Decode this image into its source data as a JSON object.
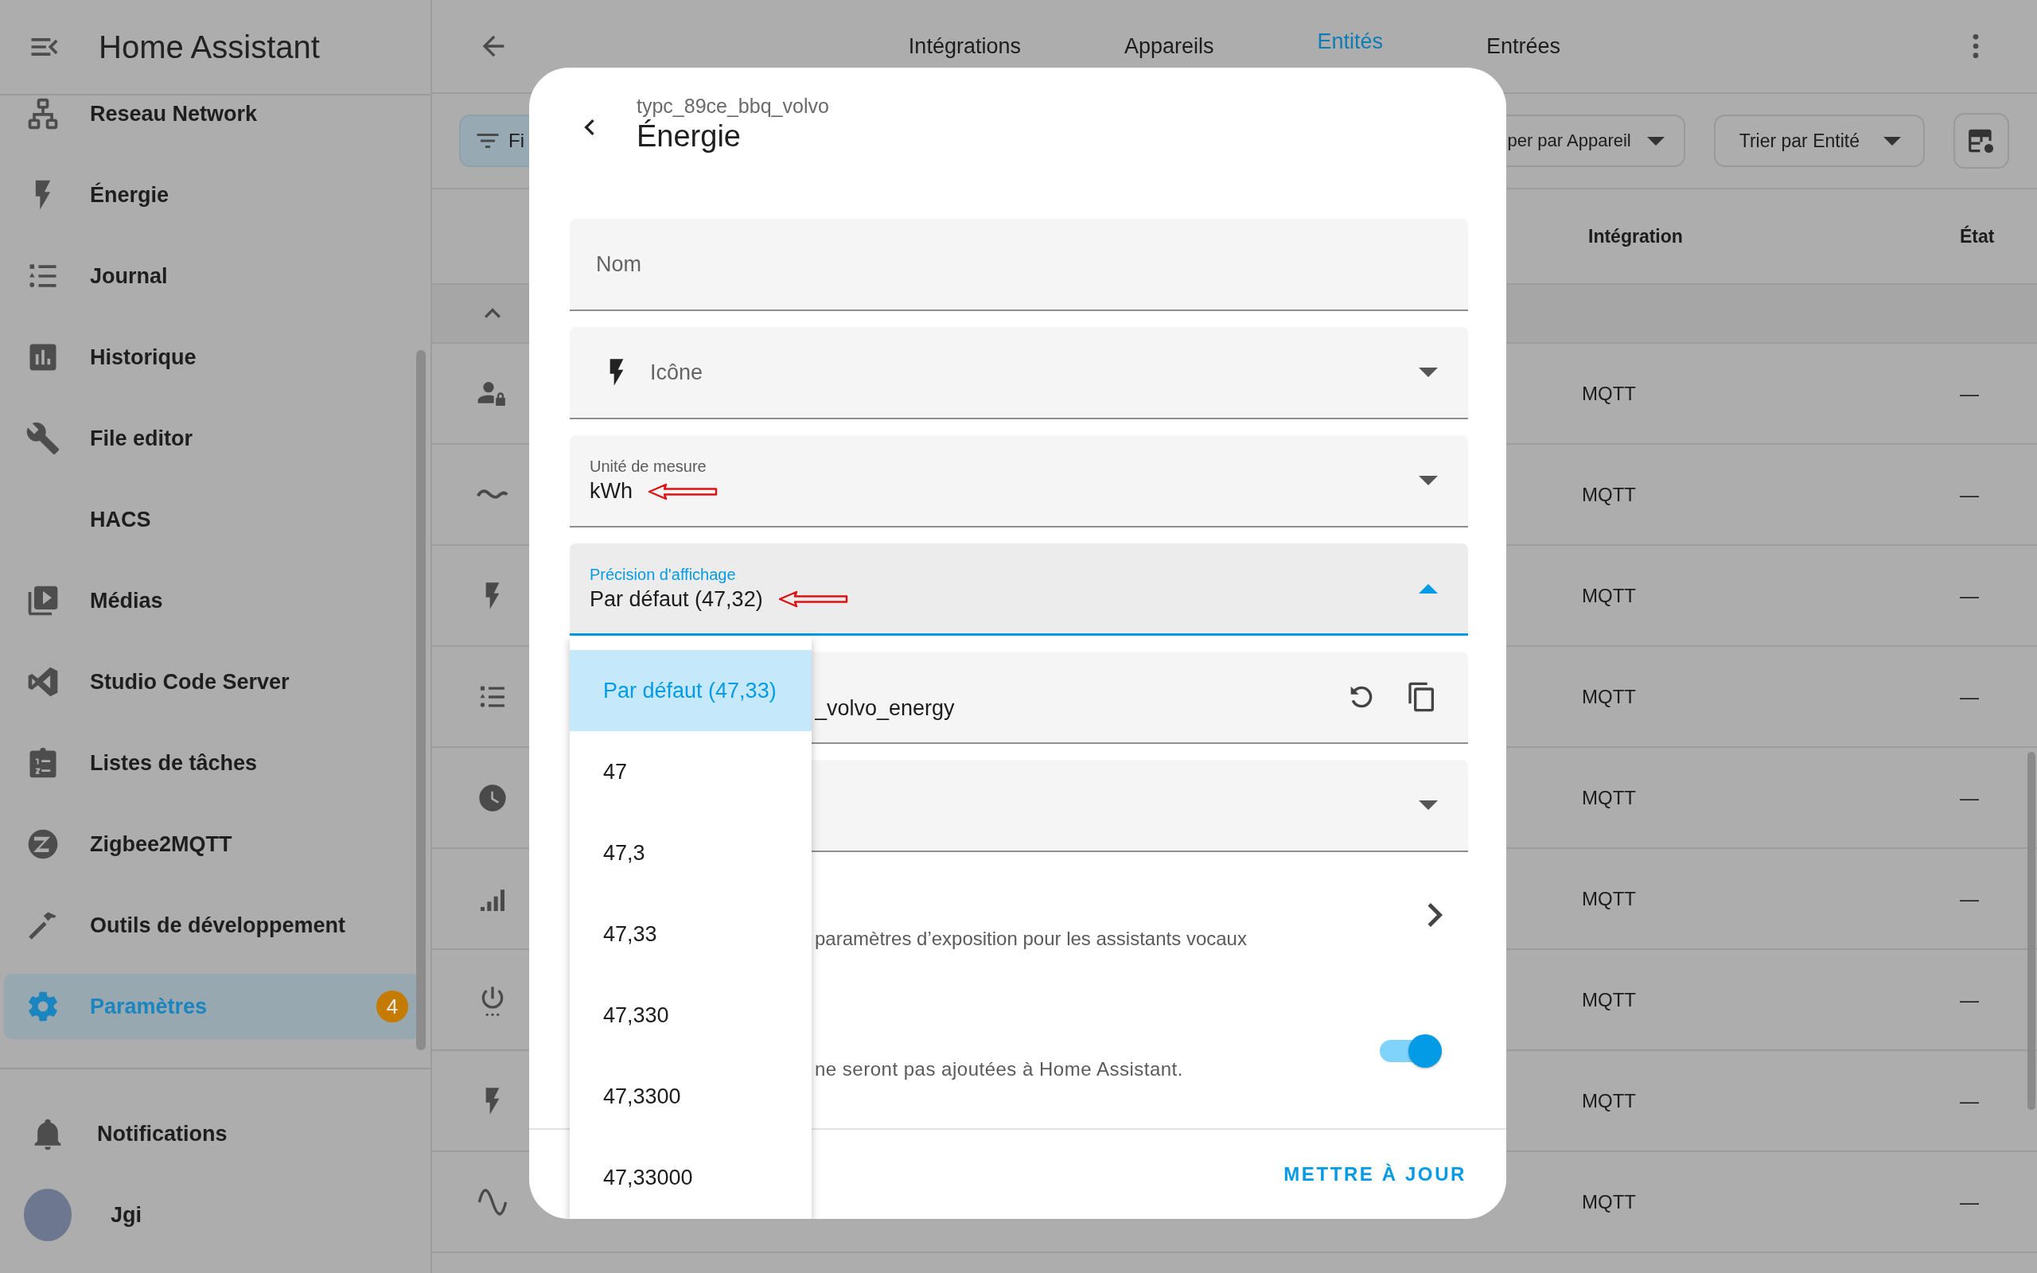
{
  "sidebar": {
    "title": "Home Assistant",
    "items": [
      {
        "label": "Reseau Network",
        "selected": false
      },
      {
        "label": "Énergie",
        "selected": false
      },
      {
        "label": "Journal",
        "selected": false
      },
      {
        "label": "Historique",
        "selected": false
      },
      {
        "label": "File editor",
        "selected": false
      },
      {
        "label": "HACS",
        "selected": false
      },
      {
        "label": "Médias",
        "selected": false
      },
      {
        "label": "Studio Code Server",
        "selected": false
      },
      {
        "label": "Listes de tâches",
        "selected": false
      },
      {
        "label": "Zigbee2MQTT",
        "selected": false
      },
      {
        "label": "Outils de développement",
        "selected": false
      },
      {
        "label": "Paramètres",
        "selected": true,
        "badge": "4"
      }
    ],
    "notifications": "Notifications",
    "user": "Jgi"
  },
  "top_bar": {
    "tabs": [
      {
        "label": "Intégrations",
        "selected": false
      },
      {
        "label": "Appareils",
        "selected": false
      },
      {
        "label": "Entités",
        "selected": true
      },
      {
        "label": "Entrées",
        "selected": false
      }
    ]
  },
  "toolbar": {
    "filter_button": "Fi",
    "group_button": "per par Appareil",
    "sort_button": "Trier par Entité"
  },
  "table": {
    "columns": [
      "Intégration",
      "État"
    ],
    "rows": [
      {
        "integration": "MQTT",
        "state": "—"
      },
      {
        "integration": "MQTT",
        "state": "—"
      },
      {
        "integration": "MQTT",
        "state": "—"
      },
      {
        "integration": "MQTT",
        "state": "—"
      },
      {
        "integration": "MQTT",
        "state": "—"
      },
      {
        "integration": "MQTT",
        "state": "—"
      },
      {
        "integration": "MQTT",
        "state": "—"
      },
      {
        "integration": "MQTT",
        "state": "—"
      },
      {
        "integration": "MQTT",
        "state": "—"
      }
    ]
  },
  "dialog": {
    "subtitle": "typc_89ce_bbq_volvo",
    "title": "Énergie",
    "fields": [
      {
        "kind": "text",
        "placeholder": "Nom"
      },
      {
        "kind": "icon_picker",
        "placeholder": "Icône"
      },
      {
        "kind": "select",
        "label": "Unité de mesure",
        "value": "kWh",
        "expanded": false,
        "annotated": true
      },
      {
        "kind": "select",
        "label": "Précision d'affichage",
        "value": "Par défaut (47,32)",
        "expanded": true,
        "annotated": true
      },
      {
        "kind": "entity_id",
        "value": "_volvo_energy"
      },
      {
        "kind": "select",
        "expanded": false
      }
    ],
    "voice_row": {
      "text": "paramètres d’exposition pour les assistants vocaux"
    },
    "toggle_row": {
      "text": "ne seront pas ajoutées à Home Assistant.",
      "on": true
    },
    "update_button": "METTRE À JOUR",
    "menu": {
      "options": [
        {
          "label": "Par défaut (47,33)",
          "selected": true
        },
        {
          "label": "47",
          "selected": false
        },
        {
          "label": "47,3",
          "selected": false
        },
        {
          "label": "47,33",
          "selected": false
        },
        {
          "label": "47,330",
          "selected": false
        },
        {
          "label": "47,3300",
          "selected": false
        },
        {
          "label": "47,33000",
          "selected": false
        }
      ]
    }
  }
}
